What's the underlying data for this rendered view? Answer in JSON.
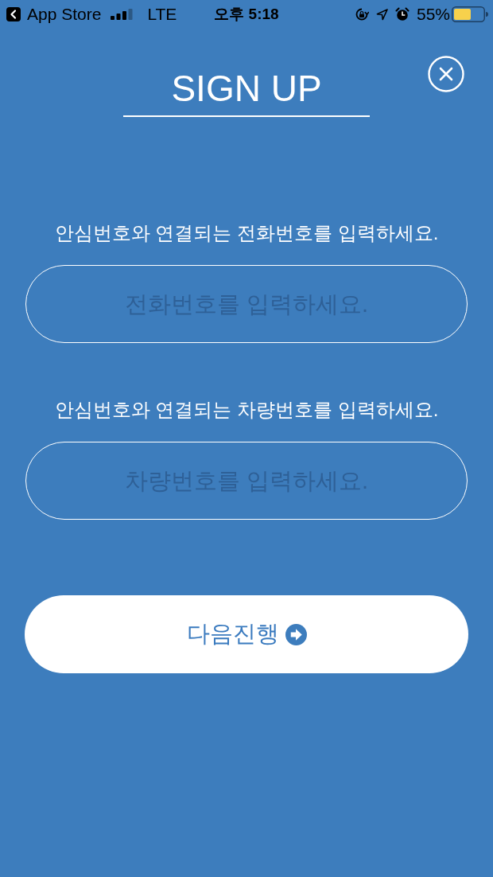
{
  "status_bar": {
    "back_label": "App Store",
    "network": "LTE",
    "time": "오후 5:18",
    "battery": "55%"
  },
  "title": "SIGN UP",
  "fields": [
    {
      "label": "안심번호와 연결되는 전화번호를 입력하세요.",
      "placeholder": "전화번호를 입력하세요."
    },
    {
      "label": "안심번호와 연결되는 차량번호를 입력하세요.",
      "placeholder": "차량번호를 입력하세요."
    }
  ],
  "next_button": {
    "label": "다음진행"
  }
}
